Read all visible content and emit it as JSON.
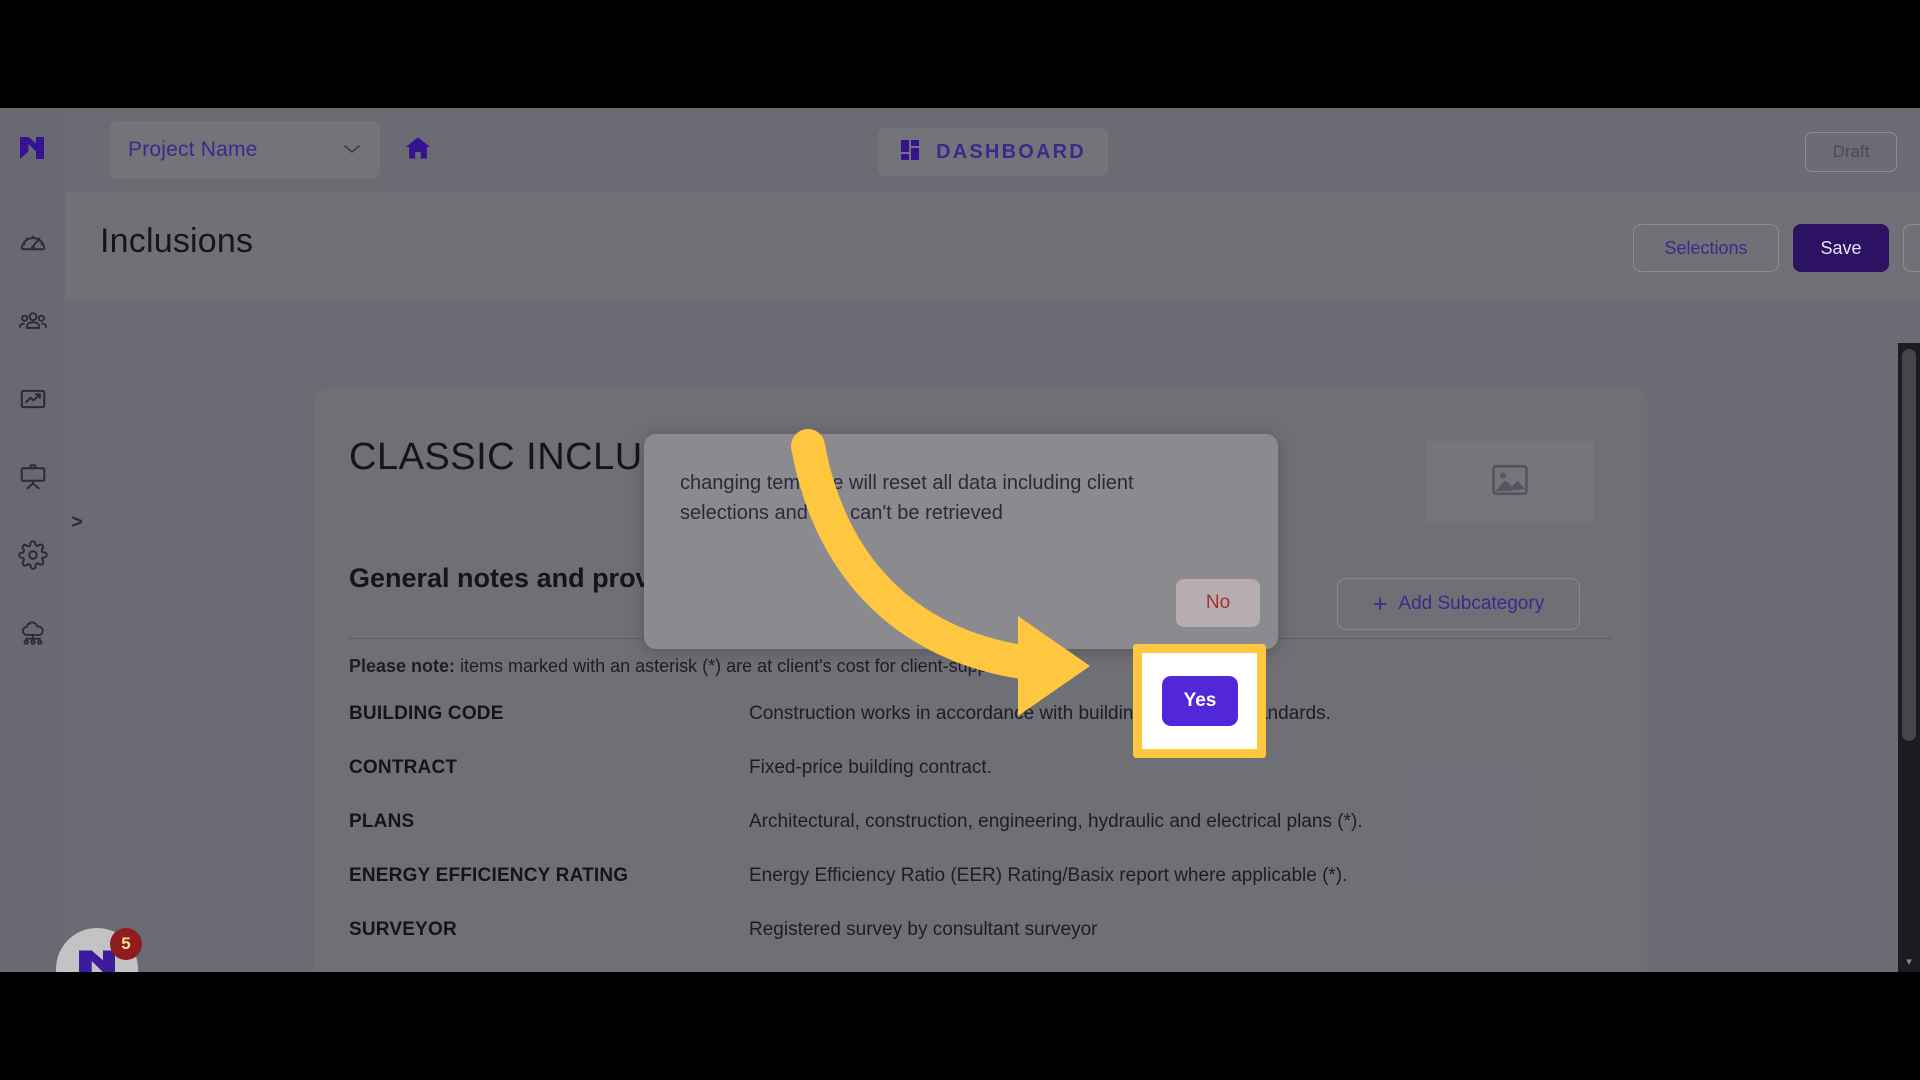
{
  "topbar": {
    "project_name": "Project Name",
    "project_chevron": "chevron-down",
    "home_icon": "home-icon",
    "dashboard_label": "DASHBOARD",
    "dashboard_icon": "grid-icon",
    "draft_label": "Draft",
    "kebab_icon": "kebab-menu-icon"
  },
  "sidebar": {
    "logo": "m-logo",
    "expand_chevron": ">",
    "items": [
      {
        "name": "dashboard-gauge-icon"
      },
      {
        "name": "team-people-icon"
      },
      {
        "name": "analytics-chart-icon"
      },
      {
        "name": "presentation-board-icon"
      },
      {
        "name": "settings-gear-icon"
      },
      {
        "name": "cloud-network-icon"
      }
    ]
  },
  "page": {
    "title": "Inclusions",
    "selections_label": "Selections",
    "save_label": "Save",
    "kebab_icon": "kebab-menu-icon"
  },
  "card": {
    "template_title": "CLASSIC INCLUSIONS",
    "image_placeholder_icon": "image-icon",
    "section_title": "General notes and provisions",
    "add_subcategory_label": "Add Subcategory",
    "add_subcategory_plus": "+",
    "note_prefix": "Please note:",
    "note_text": " items marked with an asterisk (*) are at client's cost for client-supplied plans",
    "rows": [
      {
        "key": "BUILDING CODE",
        "value": "Construction works in accordance with building codes and standards."
      },
      {
        "key": "CONTRACT",
        "value": "Fixed-price building contract."
      },
      {
        "key": "PLANS",
        "value": "Architectural, construction, engineering, hydraulic and electrical plans (*)."
      },
      {
        "key": "ENERGY EFFICIENCY RATING",
        "value": "Energy Efficiency Ratio (EER) Rating/Basix report where applicable (*)."
      },
      {
        "key": "SURVEYOR",
        "value": "Registered survey by consultant surveyor"
      }
    ]
  },
  "dialog": {
    "message": "changing template will reset all data including client selections and this can't be retrieved",
    "no_label": "No",
    "yes_label": "Yes"
  },
  "chat": {
    "badge_count": "5",
    "icon": "m-logo"
  },
  "scrollbar": {
    "down_arrow": "▾"
  },
  "colors": {
    "brand_purple": "#3b2a8c",
    "save_purple": "#2d1163",
    "yes_purple": "#5226d9",
    "no_red": "#a33030",
    "highlight_yellow": "#ffc63f",
    "badge_red": "#8f1d1d",
    "page_bg": "#6b6b73"
  }
}
